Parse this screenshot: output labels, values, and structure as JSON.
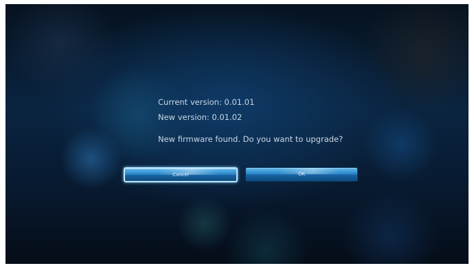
{
  "dialog": {
    "current_version": "Current version: 0.01.01",
    "new_version": "New version: 0.01.02",
    "message": "New firmware found. Do you want to upgrade?"
  },
  "buttons": {
    "cancel_label": "Cancel",
    "ok_label": "OK",
    "focused": "cancel"
  },
  "colors": {
    "button_primary": "#2b86c8",
    "focus_border": "#bfe6ff",
    "text": "#c9d8e6",
    "background": "#0a2440"
  }
}
